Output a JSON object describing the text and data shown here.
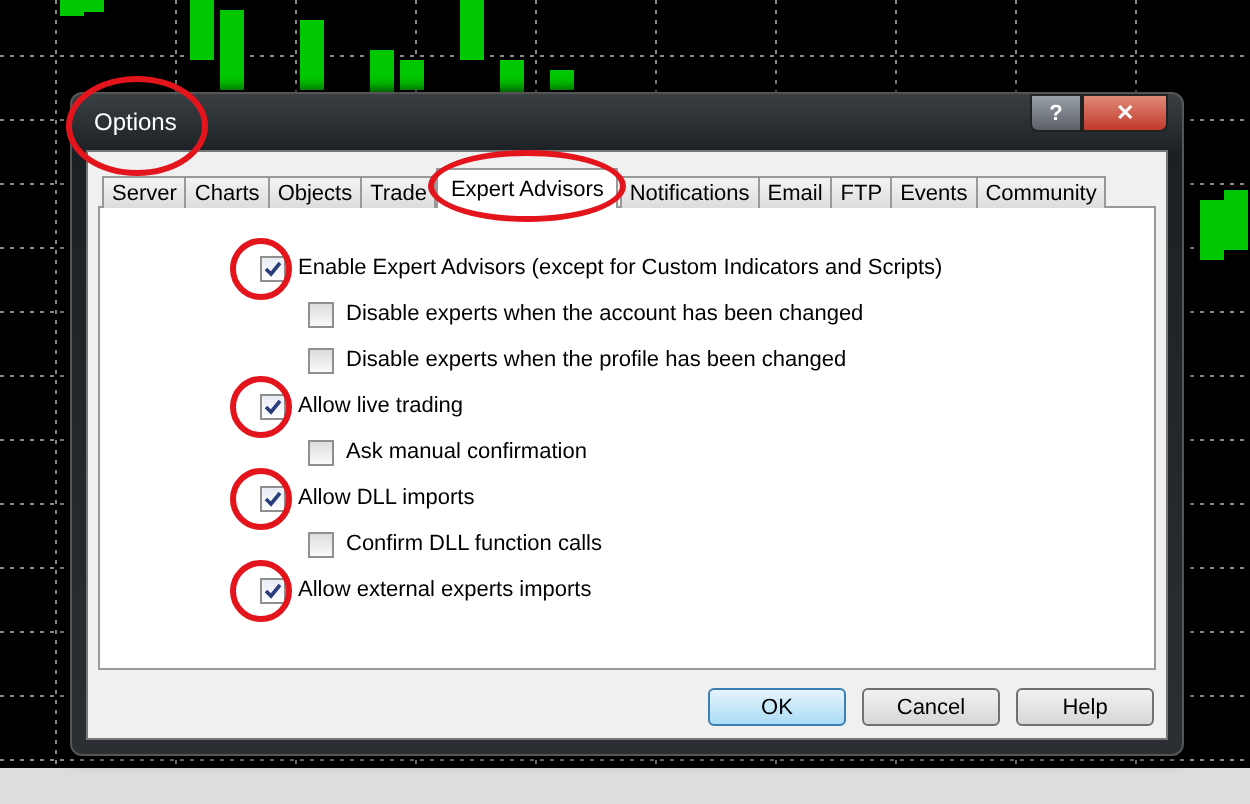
{
  "window": {
    "title": "Options",
    "highlighted": true
  },
  "title_buttons": [
    {
      "kind": "help",
      "label": "?"
    },
    {
      "kind": "close",
      "label": "✕"
    }
  ],
  "tabs": [
    {
      "label": "Server",
      "selected": false,
      "highlighted": false
    },
    {
      "label": "Charts",
      "selected": false,
      "highlighted": false
    },
    {
      "label": "Objects",
      "selected": false,
      "highlighted": false
    },
    {
      "label": "Trade",
      "selected": false,
      "highlighted": false
    },
    {
      "label": "Expert Advisors",
      "selected": true,
      "highlighted": true
    },
    {
      "label": "Notifications",
      "selected": false,
      "highlighted": false
    },
    {
      "label": "Email",
      "selected": false,
      "highlighted": false
    },
    {
      "label": "FTP",
      "selected": false,
      "highlighted": false
    },
    {
      "label": "Events",
      "selected": false,
      "highlighted": false
    },
    {
      "label": "Community",
      "selected": false,
      "highlighted": false
    }
  ],
  "options": [
    {
      "label": "Enable Expert Advisors (except for Custom Indicators and Scripts)",
      "checked": true,
      "highlighted": true,
      "children": [
        {
          "label": "Disable experts when the account has been changed",
          "checked": false,
          "highlighted": false
        },
        {
          "label": "Disable experts when the profile has been changed",
          "checked": false,
          "highlighted": false
        }
      ]
    },
    {
      "label": "Allow live trading",
      "checked": true,
      "highlighted": true,
      "children": [
        {
          "label": "Ask manual confirmation",
          "checked": false,
          "highlighted": false
        }
      ]
    },
    {
      "label": "Allow DLL imports",
      "checked": true,
      "highlighted": true,
      "children": [
        {
          "label": "Confirm DLL function calls",
          "checked": false,
          "highlighted": false
        }
      ]
    },
    {
      "label": "Allow external experts imports",
      "checked": true,
      "highlighted": true
    }
  ],
  "buttons": [
    {
      "label": "OK",
      "selected": true
    },
    {
      "label": "Cancel",
      "selected": false
    },
    {
      "label": "Help",
      "selected": false
    }
  ]
}
